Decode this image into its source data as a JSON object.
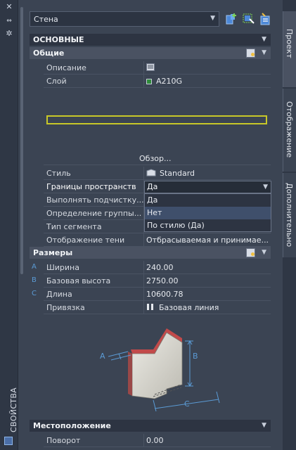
{
  "left_strip": {
    "vertical_title": "СВОЙСТВА"
  },
  "topbar": {
    "object_type": "Стена"
  },
  "sections": {
    "main_title": "ОСНОВНЫЕ",
    "location_title": "Местоположение"
  },
  "general": {
    "title": "Общие",
    "rows": [
      {
        "label": "Описание",
        "value": ""
      },
      {
        "label": "Слой",
        "value": "A210G",
        "color": "#2e8b3a"
      },
      {
        "label": "Стиль",
        "value": "Standard"
      },
      {
        "label": "Границы пространств",
        "value": "Да"
      },
      {
        "label": "Выполнять подчистку...",
        "value": ""
      },
      {
        "label": "Определение группы...",
        "value": ""
      },
      {
        "label": "Тип сегмента",
        "value": ""
      },
      {
        "label": "Отображение тени",
        "value": "Отбрасываемая и принимае..."
      }
    ],
    "browse_label": "Обзор..."
  },
  "dropdown": {
    "selected": "Да",
    "options": [
      "Да",
      "Нет",
      "По стилю (Да)"
    ],
    "highlighted_index": 1
  },
  "dimensions": {
    "title": "Размеры",
    "rows": [
      {
        "marker": "A",
        "label": "Ширина",
        "value": "240.00"
      },
      {
        "marker": "B",
        "label": "Базовая высота",
        "value": "2750.00"
      },
      {
        "marker": "C",
        "label": "Длина",
        "value": "10600.78"
      },
      {
        "marker": "",
        "label": "Привязка",
        "value": "Базовая линия"
      }
    ],
    "diagram_labels": {
      "a": "A",
      "b": "B",
      "c": "C"
    }
  },
  "location": {
    "rows": [
      {
        "label": "Поворот",
        "value": "0.00"
      }
    ]
  },
  "tabs": [
    "Проект",
    "Отображение",
    "Дополнительно"
  ],
  "colors": {
    "accent_blue": "#5b9bd5",
    "layer_green": "#2e8b3a",
    "wall_highlight": "#c8c828"
  }
}
